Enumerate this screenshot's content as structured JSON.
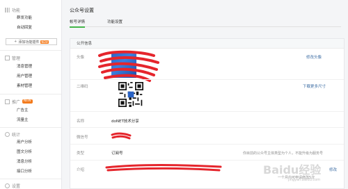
{
  "sidebar": {
    "sections": [
      {
        "title": "功能",
        "items": [
          "群发功能",
          "自动回复"
        ],
        "add_button": {
          "label": "添加功能插件",
          "badge": "NEW"
        }
      },
      {
        "title": "管理",
        "items": [
          "消息管理",
          "用户管理",
          "素材管理"
        ]
      },
      {
        "title": "推广",
        "badge": "NEW",
        "items": [
          "广告主",
          "流量主"
        ]
      },
      {
        "title": "统计",
        "items": [
          "用户分析",
          "图文分析",
          "消息分析",
          "接口分析"
        ]
      },
      {
        "title": "设置",
        "items": []
      }
    ]
  },
  "main": {
    "title": "公众号设置",
    "tabs": [
      {
        "label": "帐号详情",
        "active": true
      },
      {
        "label": "功能设置",
        "active": false
      }
    ],
    "panel": {
      "heading": "公开信息",
      "rows": [
        {
          "label": "头像",
          "link": "修改头像"
        },
        {
          "label": "二维码",
          "link": "下载更多尺寸"
        },
        {
          "label": "名称",
          "value": "doNET技术分享"
        },
        {
          "label": "微信号"
        },
        {
          "label": "类型",
          "value": "订阅号",
          "hint": "你目前的公众号主体类型为个人，不能升级为服务号"
        },
        {
          "label": "介绍",
          "link": "修改",
          "hint": "一个月内可申请修改5次"
        }
      ]
    }
  },
  "watermark": {
    "text": "Baidu经验",
    "sub": "jingyan.baidu.com"
  },
  "colors": {
    "accent_green": "#44b549",
    "link_blue": "#3e6ea4",
    "redaction": "#e5252c",
    "badge_orange": "#f37b1d"
  }
}
